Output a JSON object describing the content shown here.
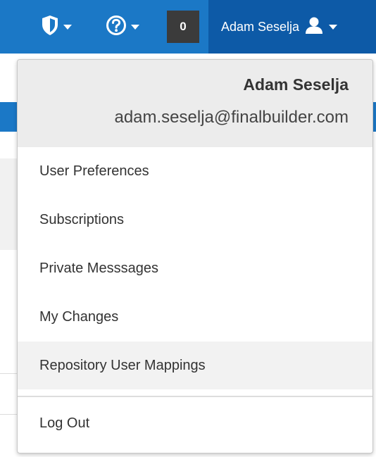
{
  "navbar": {
    "security_icon": "shield-icon",
    "help_icon": "help-circle-icon",
    "notification_count": "0",
    "user_name": "Adam Seselja",
    "user_icon": "user-icon",
    "colors": {
      "bar": "#1b78c6",
      "user_area": "#0d5aa7",
      "badge": "#3b3b3b"
    }
  },
  "user_menu": {
    "name": "Adam Seselja",
    "email": "adam.seselja@finalbuilder.com",
    "items": [
      {
        "label": "User Preferences"
      },
      {
        "label": "Subscriptions"
      },
      {
        "label": "Private Messsages"
      },
      {
        "label": "My Changes"
      },
      {
        "label": "Repository User Mappings",
        "highlighted": true
      }
    ],
    "logout_label": "Log Out"
  }
}
